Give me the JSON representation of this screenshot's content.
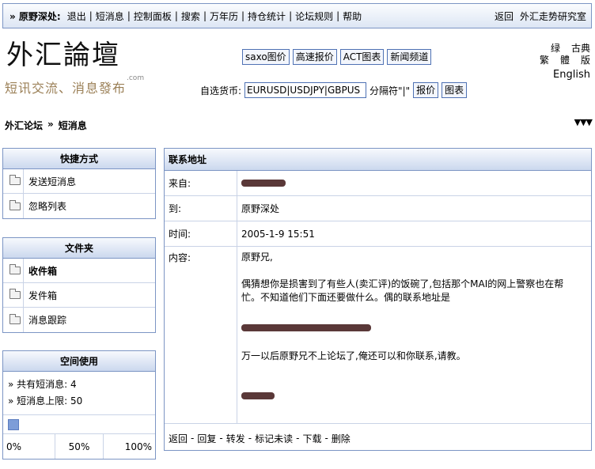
{
  "topnav": {
    "username": "» 原野深处:",
    "items": [
      "退出",
      "短消息",
      "控制面板",
      "搜索",
      "万年历",
      "持仓统计",
      "论坛规则",
      "帮助"
    ],
    "right": [
      "返回",
      "外汇走势研究室"
    ]
  },
  "logo": {
    "title": "外汇論壇",
    "subtitle": "短讯交流、消息發布",
    "domain": ".com"
  },
  "toolbar": [
    "saxo图价",
    "高速报价",
    "ACT图表",
    "新闻频道"
  ],
  "currency": {
    "label": "自选货币:",
    "value": "EURUSD|USDJPY|GBPUS",
    "hint": "分隔符\"|\"",
    "quote_btn": "报价",
    "chart_btn": "图表"
  },
  "languages": {
    "simplified": "绿",
    "traditional": "繁",
    "classic_1": "古典",
    "classic_2": "體",
    "classic_3": "版",
    "english": "English"
  },
  "breadcrumb": {
    "forum": "外汇论坛",
    "sep": "»",
    "current": "短消息",
    "arrows": "▼▼▼"
  },
  "quick": {
    "title": "快捷方式",
    "items": [
      "发送短消息",
      "忽略列表"
    ]
  },
  "folders": {
    "title": "文件夹",
    "items": [
      "收件箱",
      "发件箱",
      "消息跟踪"
    ]
  },
  "space": {
    "title": "空间使用",
    "total": "» 共有短消息: 4",
    "limit": "» 短消息上限: 50",
    "usage_fraction": 0.08,
    "scale": [
      "0%",
      "50%",
      "100%"
    ]
  },
  "message": {
    "header": "联系地址",
    "from_label": "来自:",
    "to_label": "到:",
    "to_value": "原野深处",
    "time_label": "时间:",
    "time_value": "2005-1-9 15:51",
    "content_label": "内容:",
    "greeting": "原野兄,",
    "body1": "偶猜想你是损害到了有些人(卖汇评)的饭碗了,包括那个MAI的网上警察也在帮忙。不知道他们下面还要做什么。偶的联系地址是",
    "body2": "万一以后原野兄不上论坛了,俺还可以和你联系,请教。"
  },
  "actions": [
    "返回",
    "回复",
    "转发",
    "标记未读",
    "下载",
    "删除"
  ]
}
